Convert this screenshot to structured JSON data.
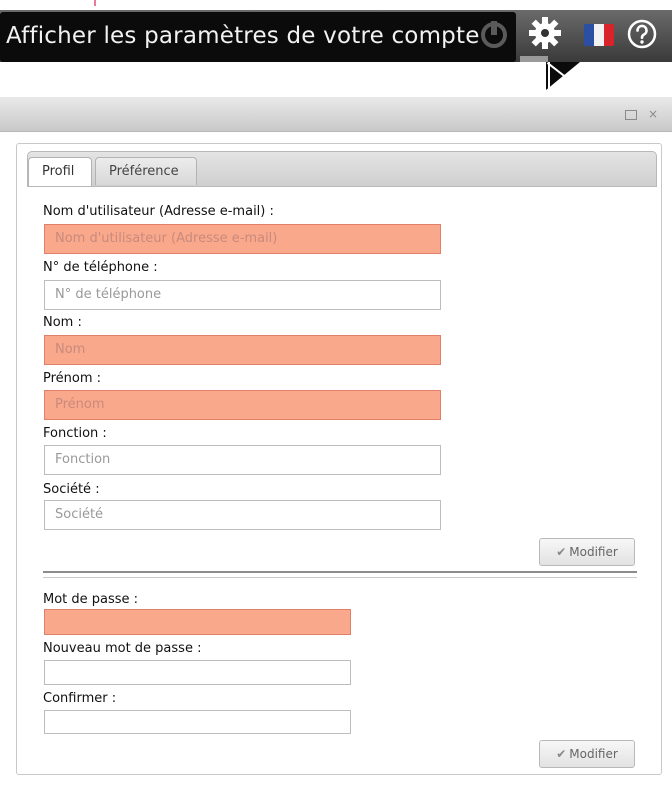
{
  "tooltip": {
    "text": "Afficher les paramètres de votre compte"
  },
  "toolbar": {
    "icons": [
      "power-icon",
      "gear-icon",
      "flag-fr-icon",
      "help-icon"
    ],
    "flag_colors": [
      "#2a4fa3",
      "#f2f2f2",
      "#d8232a"
    ]
  },
  "window": {
    "controls": [
      "maximize-icon",
      "close-icon"
    ],
    "close_glyph": "×"
  },
  "tabs": [
    {
      "label": "Profil",
      "active": true
    },
    {
      "label": "Préférence",
      "active": false
    }
  ],
  "profile": {
    "fields": [
      {
        "label": "Nom d'utilisateur (Adresse e-mail) :",
        "placeholder": "Nom d'utilisateur (Adresse e-mail)",
        "required": true
      },
      {
        "label": "N° de téléphone :",
        "placeholder": "N° de téléphone",
        "required": false
      },
      {
        "label": "Nom :",
        "placeholder": "Nom",
        "required": true
      },
      {
        "label": "Prénom :",
        "placeholder": "Prénom",
        "required": true
      },
      {
        "label": "Fonction :",
        "placeholder": "Fonction",
        "required": false
      },
      {
        "label": "Société :",
        "placeholder": "Société",
        "required": false
      }
    ],
    "modify_label": "Modifier"
  },
  "password": {
    "fields": [
      {
        "label": "Mot de passe :",
        "required": true
      },
      {
        "label": "Nouveau mot de passe :",
        "required": false
      },
      {
        "label": "Confirmer :",
        "required": false
      }
    ],
    "modify_label": "Modifier"
  },
  "colors": {
    "required_bg": "#f9a88c",
    "tooltip_bg": "#0b0b0b"
  }
}
